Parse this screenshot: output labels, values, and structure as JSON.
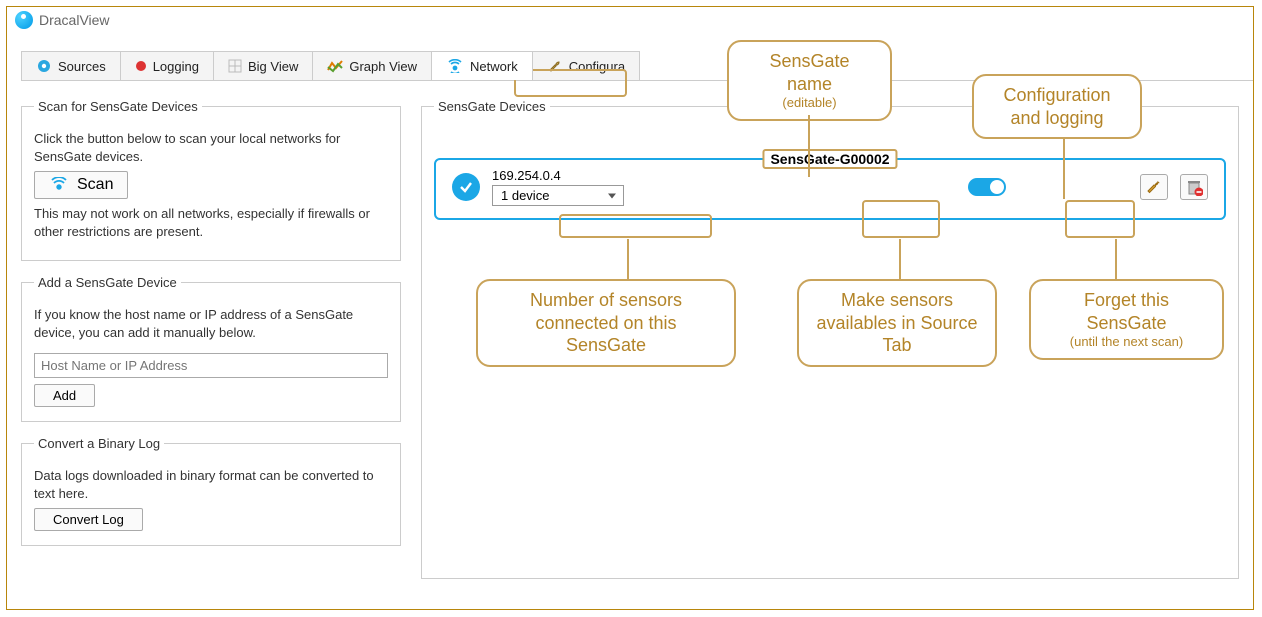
{
  "app": {
    "title": "DracalView"
  },
  "tabs": {
    "sources": "Sources",
    "logging": "Logging",
    "bigview": "Big View",
    "graphview": "Graph View",
    "network": "Network",
    "configuration": "Configura"
  },
  "scan": {
    "legend": "Scan for SensGate Devices",
    "desc": "Click the button below to scan your local networks for SensGate devices.",
    "button": "Scan",
    "warn": "This may not work on all networks, especially if firewalls or other restrictions are present."
  },
  "add": {
    "legend": "Add a SensGate Device",
    "desc": "If you know the host name or IP address of a SensGate device, you can add it manually below.",
    "placeholder": "Host Name or IP Address",
    "button": "Add"
  },
  "convert": {
    "legend": "Convert a Binary Log",
    "desc": "Data logs downloaded in binary format can be converted to text here.",
    "button": "Convert Log"
  },
  "devices": {
    "legend": "SensGate Devices",
    "card": {
      "name": "SensGate-G00002",
      "ip": "169.254.0.4",
      "device_count": "1 device"
    }
  },
  "annotations": {
    "name": {
      "title": "SensGate name",
      "sub": "(editable)"
    },
    "config": {
      "title": "Configuration and logging"
    },
    "sensors_count": {
      "title": "Number of sensors connected on this SensGate"
    },
    "make_available": {
      "title": "Make sensors availables  in Source Tab"
    },
    "forget": {
      "title": "Forget this SensGate",
      "sub": "(until the next scan)"
    }
  }
}
